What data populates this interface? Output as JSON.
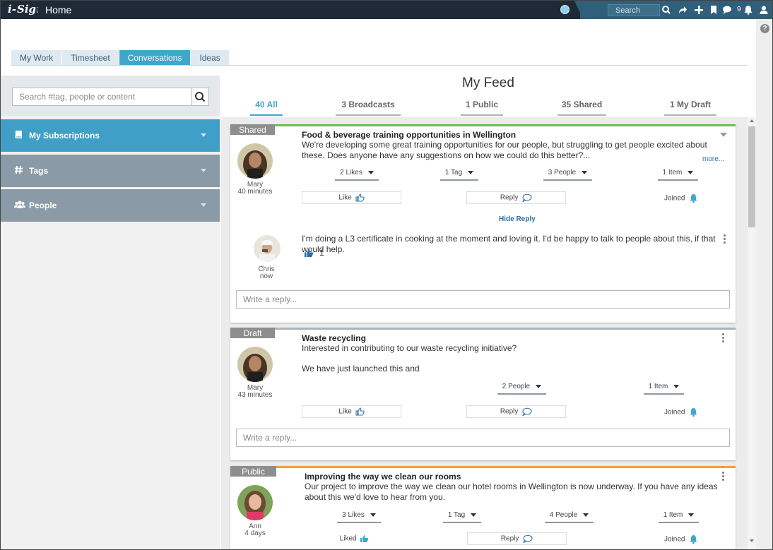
{
  "app": {
    "logo_text": "i-Sign",
    "page_title": "Home",
    "search_placeholder": "Search",
    "notification_count": "9",
    "colors": {
      "topbar": "#1e2a38",
      "accent": "#3fa7cc",
      "shared": "#6cbf4a",
      "draft": "#aab4bb",
      "public": "#f0a23a"
    }
  },
  "tabs": [
    {
      "label": "My Work",
      "active": false
    },
    {
      "label": "Timesheet",
      "active": false
    },
    {
      "label": "Conversations",
      "active": true
    },
    {
      "label": "Ideas",
      "active": false
    }
  ],
  "sidebar": {
    "search_placeholder": "Search #tag, people or content",
    "sections": [
      {
        "label": "My Subscriptions",
        "icon": "book-icon"
      },
      {
        "label": "Tags",
        "icon": "hash-icon"
      },
      {
        "label": "People",
        "icon": "users-icon"
      }
    ]
  },
  "feed": {
    "title": "My Feed",
    "filters": [
      {
        "label": "40 All",
        "active": true
      },
      {
        "label": "3 Broadcasts",
        "active": false
      },
      {
        "label": "1 Public",
        "active": false
      },
      {
        "label": "35 Shared",
        "active": false
      },
      {
        "label": "1 My Draft",
        "active": false
      }
    ],
    "posts": [
      {
        "badge": "Shared",
        "author": "Mary",
        "time": "40 minutes",
        "title": "Food & beverage training opportunities in Wellington",
        "body": "We're developing some great training opportunities for our people, but struggling to get people excited about these. Does anyone have any suggestions on how we could do this better?...",
        "more": "more...",
        "pills": [
          "2 Likes",
          "1 Tag",
          "3 People",
          "1 Item"
        ],
        "like_label": "Like",
        "reply_label": "Reply",
        "joined_label": "Joined",
        "hide_reply": "Hide Reply",
        "reply": {
          "author": "Chris",
          "time": "now",
          "text": "I'm doing a L3 certificate in cooking at the moment and loving it. I'd be happy to talk to people about this, if that would help.",
          "likes": "1"
        },
        "reply_placeholder": "Write a reply..."
      },
      {
        "badge": "Draft",
        "author": "Mary",
        "time": "43 minutes",
        "title": "Waste recycling",
        "body_line1": "Interested in contributing to our waste recycling initiative?",
        "body_line2": "We have just launched this and",
        "pills": [
          "2 People",
          "1 Item"
        ],
        "like_label": "Like",
        "reply_label": "Reply",
        "joined_label": "Joined",
        "reply_placeholder": "Write a reply..."
      },
      {
        "badge": "Public",
        "author": "Ann",
        "time": "4 days",
        "title": "Improving the way we clean our rooms",
        "body": "Our project to improve the way we clean our hotel rooms in Wellington is now underway.  If you have any ideas about this we'd love to hear from you.",
        "pills": [
          "3 Likes",
          "1 Tag",
          "4 People",
          "1 Item"
        ],
        "like_label": "Liked",
        "reply_label": "Reply",
        "joined_label": "Joined"
      }
    ]
  }
}
